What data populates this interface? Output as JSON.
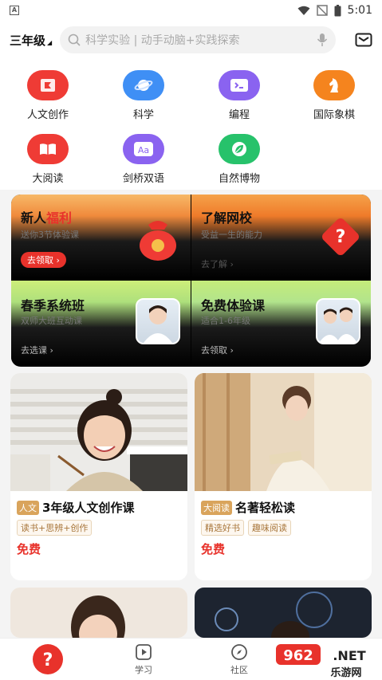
{
  "status": {
    "corner": "A",
    "time": "5:01"
  },
  "header": {
    "grade": "三年级",
    "search_placeholder": "科学实验 | 动手动脑+实践探索"
  },
  "categories": [
    {
      "label": "人文创作",
      "icon": "flag-book-icon",
      "color": "#ef3b35"
    },
    {
      "label": "科学",
      "icon": "planet-icon",
      "color": "#3f8ff5"
    },
    {
      "label": "编程",
      "icon": "code-icon",
      "color": "#8a63f0"
    },
    {
      "label": "国际象棋",
      "icon": "chess-knight-icon",
      "color": "#f5841e"
    },
    {
      "label": "大阅读",
      "icon": "open-book-icon",
      "color": "#ef3b35"
    },
    {
      "label": "剑桥双语",
      "icon": "aa-letters-icon",
      "color": "#8a63f0"
    },
    {
      "label": "自然博物",
      "icon": "leaf-icon",
      "color": "#27c26b"
    }
  ],
  "promos": [
    {
      "title": "新人",
      "title_hl": "福利",
      "sub": "送你3节体验课",
      "cta": "去领取 ›"
    },
    {
      "title": "了解网校",
      "sub": "受益一生的能力",
      "cta": "去了解 ›"
    },
    {
      "title": "春季系统班",
      "sub": "双师大班互动课",
      "cta": "去选课 ›"
    },
    {
      "title": "免费体验课",
      "sub": "适合1-6年级",
      "cta": "去领取 ›"
    }
  ],
  "courses": [
    {
      "tag": "人文",
      "name": "3年级人文创作课",
      "chips": [
        "读书+思辨+创作"
      ],
      "price": "免费"
    },
    {
      "tag": "大阅读",
      "name": "名著轻松读",
      "chips": [
        "精选好书",
        "趣味阅读"
      ],
      "price": "免费"
    }
  ],
  "nav": {
    "study": "学习",
    "community": "社区"
  },
  "watermark": {
    "brand": "962.NET",
    "site": "乐游网"
  },
  "colors": {
    "accent_red": "#e8322b",
    "tag_gold": "#d9a45c"
  }
}
